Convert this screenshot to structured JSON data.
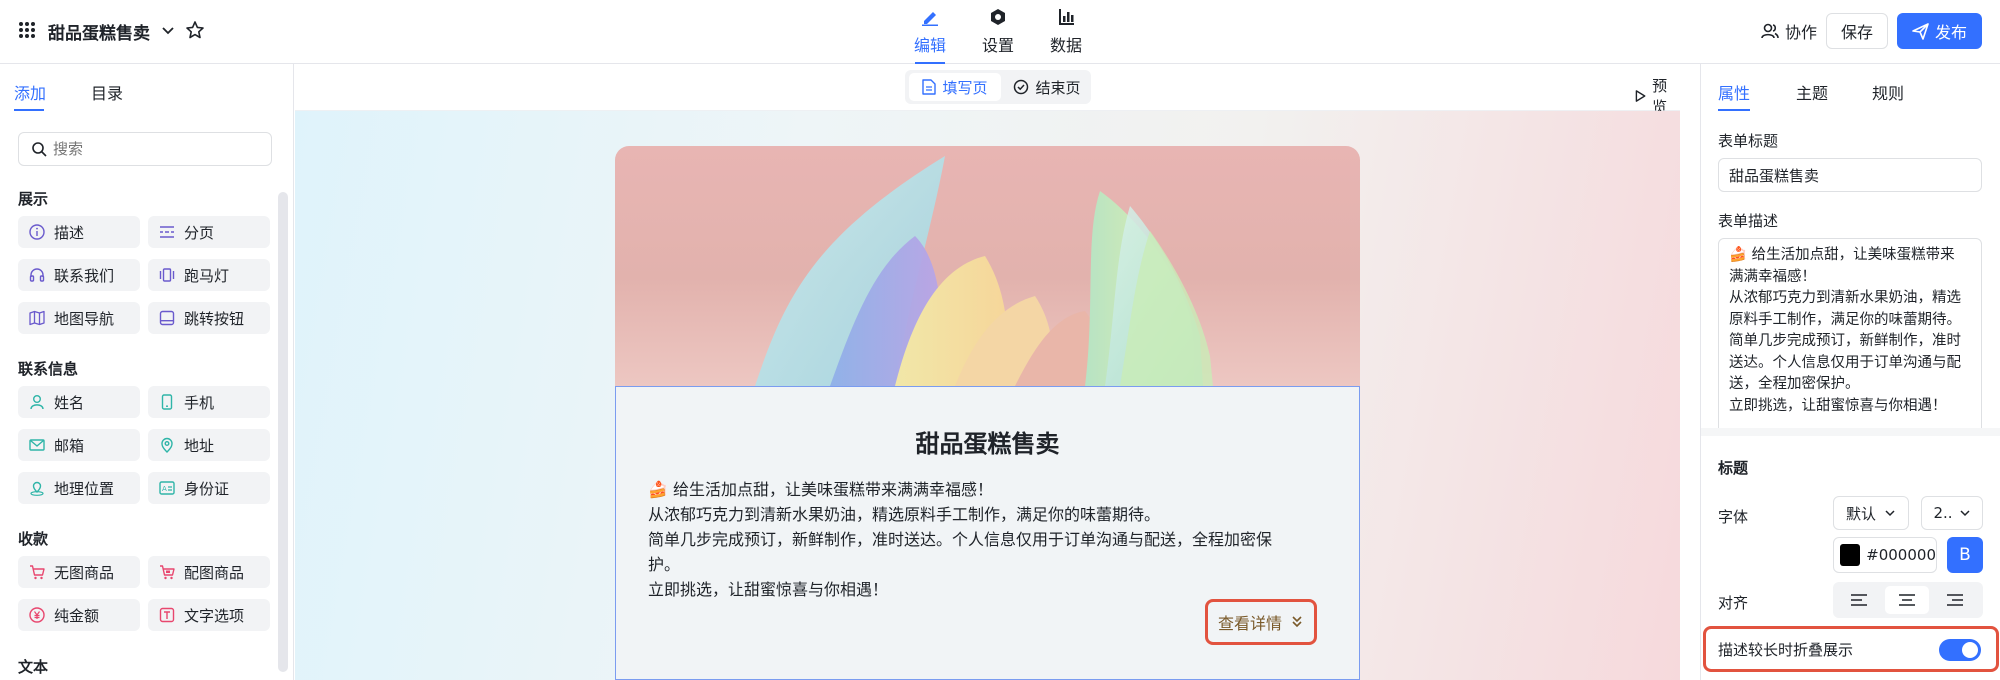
{
  "app": {
    "title": "甜品蛋糕售卖"
  },
  "top_tabs": [
    {
      "label": "编辑",
      "icon": "edit-icon",
      "active": true
    },
    {
      "label": "设置",
      "icon": "settings-icon",
      "active": false
    },
    {
      "label": "数据",
      "icon": "chart-icon",
      "active": false
    }
  ],
  "header_actions": {
    "collaborate": "协作",
    "save": "保存",
    "publish": "发布"
  },
  "left": {
    "tabs": [
      {
        "label": "添加",
        "active": true
      },
      {
        "label": "目录",
        "active": false
      }
    ],
    "search_placeholder": "搜索",
    "groups": [
      {
        "title": "展示",
        "items": [
          {
            "label": "描述",
            "icon": "info-icon"
          },
          {
            "label": "分页",
            "icon": "pagination-icon"
          },
          {
            "label": "联系我们",
            "icon": "headset-icon"
          },
          {
            "label": "跑马灯",
            "icon": "marquee-icon"
          },
          {
            "label": "地图导航",
            "icon": "map-icon"
          },
          {
            "label": "跳转按钮",
            "icon": "jump-button-icon"
          }
        ]
      },
      {
        "title": "联系信息",
        "items": [
          {
            "label": "姓名",
            "icon": "user-icon"
          },
          {
            "label": "手机",
            "icon": "phone-icon"
          },
          {
            "label": "邮箱",
            "icon": "mail-icon"
          },
          {
            "label": "地址",
            "icon": "location-pin-icon"
          },
          {
            "label": "地理位置",
            "icon": "geo-location-icon"
          },
          {
            "label": "身份证",
            "icon": "id-card-icon"
          }
        ]
      },
      {
        "title": "收款",
        "items": [
          {
            "label": "无图商品",
            "icon": "cart-icon"
          },
          {
            "label": "配图商品",
            "icon": "cart-image-icon"
          },
          {
            "label": "纯金额",
            "icon": "yen-icon"
          },
          {
            "label": "文字选项",
            "icon": "text-option-icon"
          }
        ]
      },
      {
        "title": "文本",
        "items": []
      }
    ]
  },
  "center": {
    "page_tabs": [
      {
        "label": "填写页",
        "active": true
      },
      {
        "label": "结束页",
        "active": false
      }
    ],
    "preview": "预览",
    "form": {
      "title": "甜品蛋糕售卖",
      "description_lines": [
        "🍰 给生活加点甜，让美味蛋糕带来满满幸福感！",
        "从浓郁巧克力到清新水果奶油，精选原料手工制作，满足你的味蕾期待。",
        "简单几步完成预订，新鲜制作，准时送达。个人信息仅用于订单沟通与配送，全程加密保",
        "护。",
        "立即挑选，让甜蜜惊喜与你相遇！"
      ],
      "details_button": "查看详情"
    }
  },
  "right": {
    "tabs": [
      {
        "label": "属性",
        "active": true
      },
      {
        "label": "主题",
        "active": false
      },
      {
        "label": "规则",
        "active": false
      }
    ],
    "form_title_label": "表单标题",
    "form_title_value": "甜品蛋糕售卖",
    "form_desc_label": "表单描述",
    "form_desc_lines": [
      "🍰 给生活加点甜，让美味蛋糕带来",
      "满满幸福感！",
      "从浓郁巧克力到清新水果奶油，精选",
      "原料手工制作，满足你的味蕾期待。",
      "简单几步完成预订，新鲜制作，准时",
      "送达。个人信息仅用于订单沟通与配",
      "送，全程加密保护。",
      "立即挑选，让甜蜜惊喜与你相遇！"
    ],
    "heading_section": "标题",
    "font_label": "字体",
    "font_family_value": "默认",
    "font_size_value": "2..",
    "color_value": "#000000",
    "bold_label": "B",
    "align_label": "对齐",
    "collapse_label": "描述较长时折叠展示",
    "collapse_enabled": true
  },
  "colors": {
    "accent": "#3370ff",
    "highlight": "#e2533f"
  }
}
